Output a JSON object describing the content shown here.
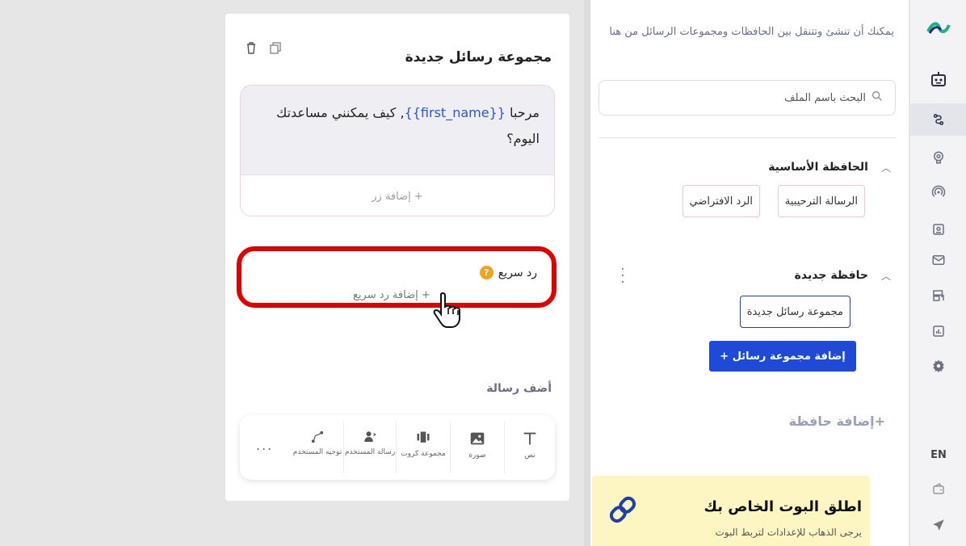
{
  "rail": {
    "lang": "EN"
  },
  "side": {
    "description": "يمكنك أن تنشئ وتتنقل بين الحافظات ومجموعات الرسائل من هنا",
    "search_placeholder": "البحث باسم الملف",
    "main_folder": {
      "title": "الحافظة الأساسية",
      "items": [
        "الرسالة الترحيبية",
        "الرد الافتراضي"
      ]
    },
    "new_folder": {
      "title": "حافظة جديدة",
      "items": [
        "مجموعة رسائل جديدة"
      ],
      "add_group_label": "إضافة مجموعة رسائل +"
    },
    "add_folder_label": "+إضافة حافظة",
    "promo": {
      "title": "اطلق البوت الخاص بك",
      "subtitle": "يرجى الذهاب للإعدادات لتربط البوت"
    }
  },
  "card": {
    "title": "مجموعة رسائل جديدة",
    "message": {
      "prefix": "مرحبا ",
      "variable": "{{first_name}}",
      "suffix": ", كيف يمكنني مساعدتك اليوم؟",
      "add_button_label": "+ إضافة زر"
    },
    "quick_reply": {
      "label": "رد سريع",
      "help": "?",
      "add_label": "+ إضافة رد سريع"
    },
    "add_message_title": "أضف رسالة",
    "tools": [
      {
        "label": "نص"
      },
      {
        "label": "صورة"
      },
      {
        "label": "مجموعة كروت"
      },
      {
        "label": "رسالة المستخدم"
      },
      {
        "label": "توجيه المستخدم"
      }
    ],
    "more": "..."
  },
  "colors": {
    "accent": "#1f4ad8",
    "highlight": "#e00000",
    "promo_bg": "#fdf6c3"
  }
}
